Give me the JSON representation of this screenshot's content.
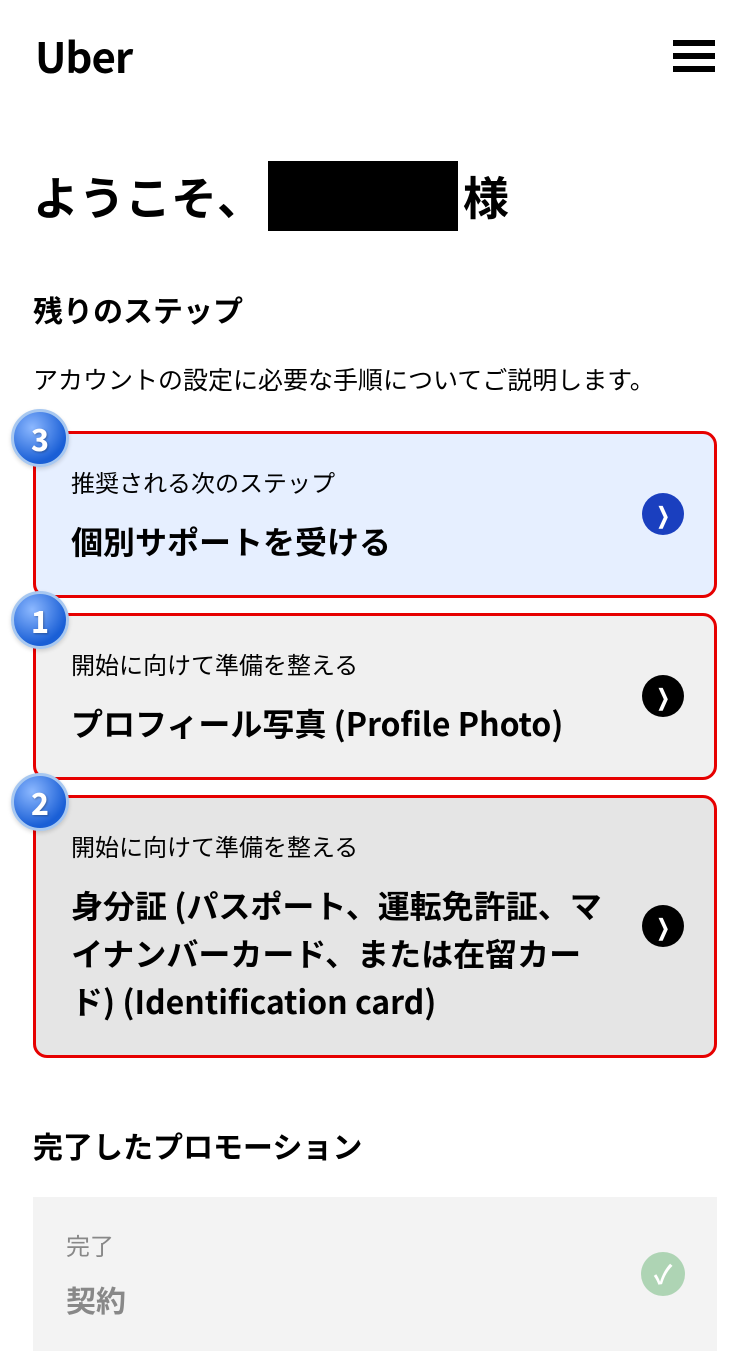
{
  "header": {
    "logo": "Uber"
  },
  "greeting": {
    "prefix": "ようこそ、",
    "suffix": "様"
  },
  "remaining": {
    "title": "残りのステップ",
    "description": "アカウントの設定に必要な手順についてご説明します。"
  },
  "steps": [
    {
      "badge": "3",
      "label": "推奨される次のステップ",
      "title": "個別サポートを受ける",
      "arrow_color": "blue",
      "bg": "highlighted"
    },
    {
      "badge": "1",
      "label": "開始に向けて準備を整える",
      "title": "プロフィール写真 (Profile Photo)",
      "arrow_color": "black",
      "bg": "gray"
    },
    {
      "badge": "2",
      "label": "開始に向けて準備を整える",
      "title": "身分証 (パスポート、運転免許証、マイナンバーカード、または在留カード) (Identification card)",
      "arrow_color": "black",
      "bg": "gray2"
    }
  ],
  "completed": {
    "section_title": "完了したプロモーション",
    "items": [
      {
        "label": "完了",
        "title": "契約"
      }
    ]
  }
}
